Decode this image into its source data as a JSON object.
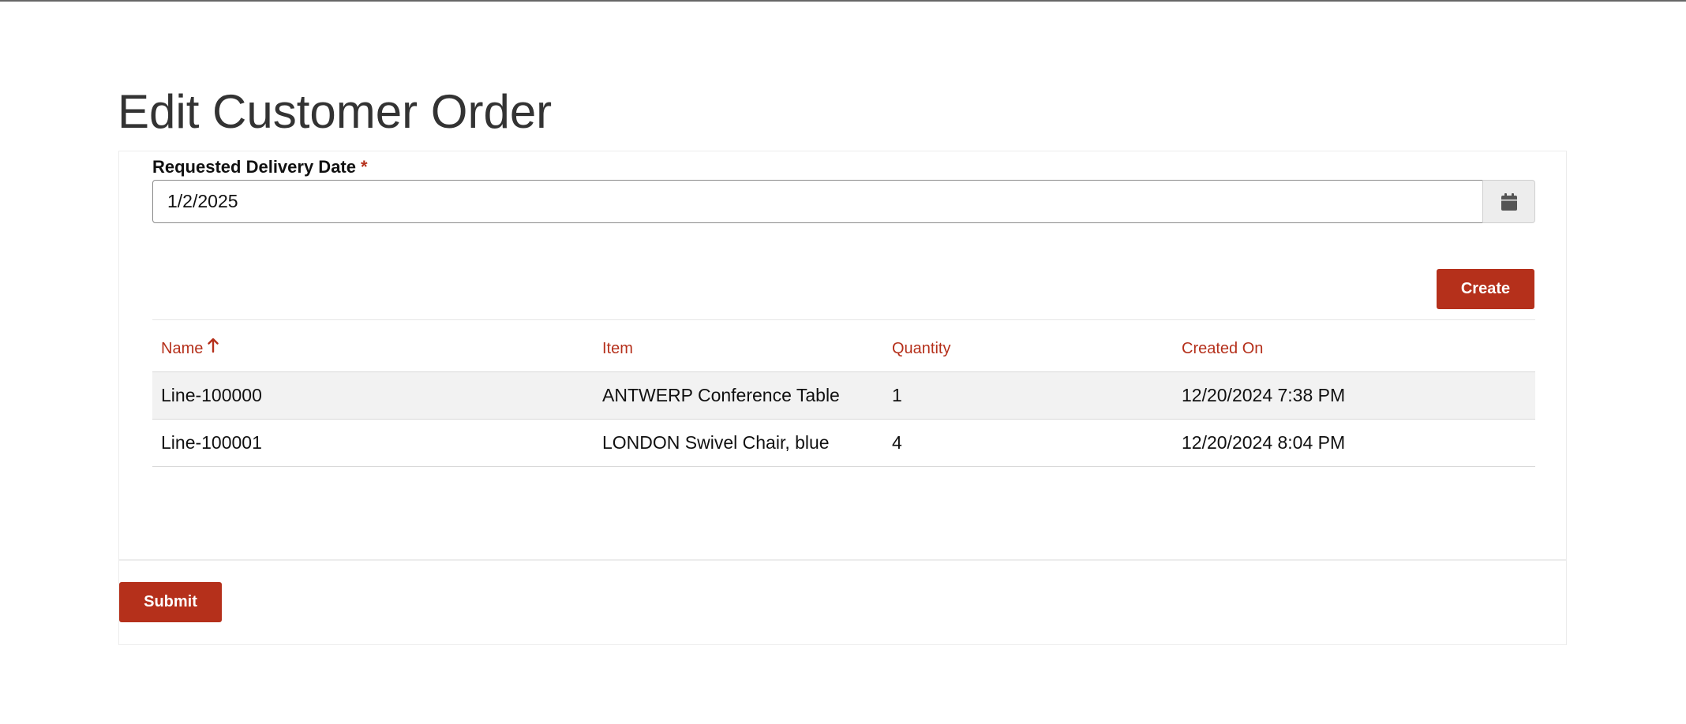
{
  "page": {
    "title": "Edit Customer Order"
  },
  "form": {
    "delivery_date_label": "Requested Delivery Date",
    "required_marker": "*",
    "delivery_date_value": "1/2/2025",
    "calendar_icon": "calendar-icon"
  },
  "toolbar": {
    "create_label": "Create"
  },
  "grid": {
    "columns": [
      {
        "label": "Name",
        "sort": "ascending"
      },
      {
        "label": "Item"
      },
      {
        "label": "Quantity"
      },
      {
        "label": "Created On"
      }
    ],
    "rows": [
      {
        "name": "Line-100000",
        "item": "ANTWERP Conference Table",
        "quantity": "1",
        "created_on": "12/20/2024 7:38 PM"
      },
      {
        "name": "Line-100001",
        "item": "LONDON Swivel Chair, blue",
        "quantity": "4",
        "created_on": "12/20/2024 8:04 PM"
      }
    ]
  },
  "footer": {
    "submit_label": "Submit"
  },
  "colors": {
    "accent": "#b5301b",
    "row_alt": "#f2f2f2",
    "title_text": "#333333"
  }
}
